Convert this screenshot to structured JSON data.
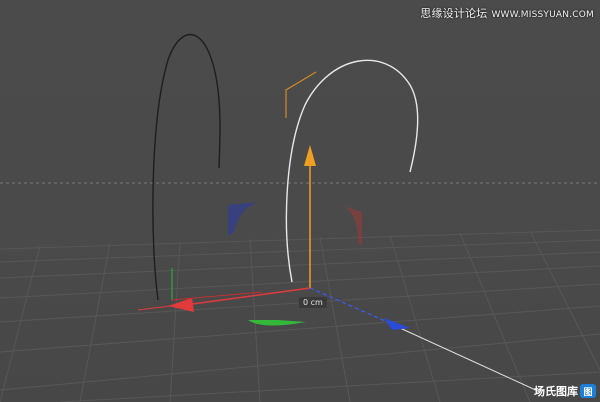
{
  "viewport": {
    "label": "3D viewport",
    "dimension_readout": "0 cm"
  },
  "watermark": {
    "title": "思缘设计论坛",
    "site": "WWW.MISSYUAN.COM"
  },
  "logo": {
    "text": "场氏图库",
    "mark": "图"
  },
  "colors": {
    "background": "#4a4a4a",
    "grid": "#5a5a5a",
    "axis_x": "#e23a3a",
    "axis_y": "#f0a020",
    "axis_z": "#2a4bd8",
    "spline_selected": "#e8e8e8",
    "spline_unselected": "#1e1e1e",
    "bounding_box": "#d08a28"
  }
}
